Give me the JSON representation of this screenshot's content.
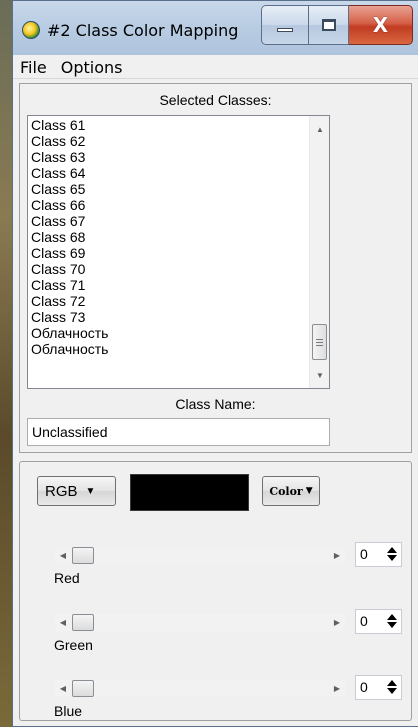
{
  "window": {
    "title": "#2 Class Color Mapping",
    "close_glyph": "X"
  },
  "menu": {
    "items": [
      "File",
      "Options"
    ]
  },
  "selected_classes": {
    "label": "Selected Classes:",
    "items": [
      "Class 61",
      "Class 62",
      "Class 63",
      "Class 64",
      "Class 65",
      "Class 66",
      "Class 67",
      "Class 68",
      "Class 69",
      "Class 70",
      "Class 71",
      "Class 72",
      "Class 73",
      "Облачность",
      "Облачность"
    ]
  },
  "class_name": {
    "label": "Class Name:",
    "value": "Unclassified"
  },
  "color_controls": {
    "mode": "RGB",
    "swatch_color": "#000000",
    "color_button_label": "Color",
    "channels": [
      {
        "label": "Red",
        "value": "0"
      },
      {
        "label": "Green",
        "value": "0"
      },
      {
        "label": "Blue",
        "value": "0"
      }
    ]
  }
}
